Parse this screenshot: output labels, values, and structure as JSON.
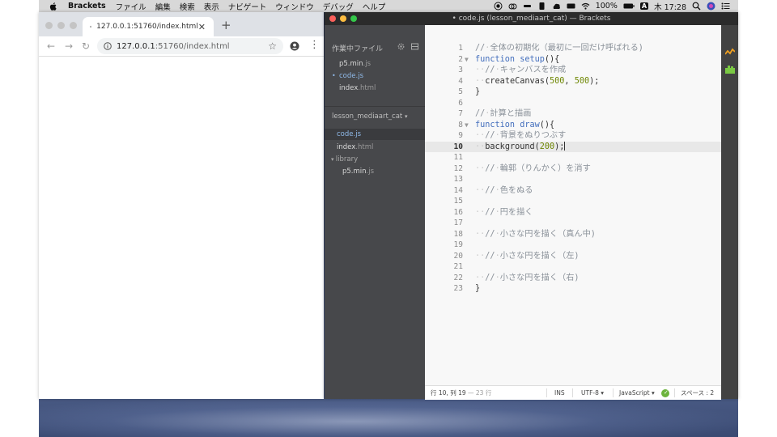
{
  "menubar": {
    "app_name": "Brackets",
    "items": [
      "ファイル",
      "編集",
      "検索",
      "表示",
      "ナビゲート",
      "ウィンドウ",
      "デバッグ",
      "ヘルプ"
    ],
    "battery": "100%",
    "input_indicator": "A",
    "clock": "木 17:28"
  },
  "chrome": {
    "tab_title": "127.0.0.1:51760/index.html",
    "url_host": "127.0.0.1",
    "url_rest": ":51760/index.html"
  },
  "brackets": {
    "title": "• code.js (lesson_mediaart_cat) — Brackets",
    "working_files_header": "作業中ファイル",
    "working_files": [
      {
        "name": "p5.min",
        "ext": ".js",
        "active": false
      },
      {
        "name": "code",
        "ext": ".js",
        "active": true
      },
      {
        "name": "index",
        "ext": ".html",
        "active": false
      }
    ],
    "project_name": "lesson_mediaart_cat",
    "project_caret": "▾",
    "tree": [
      {
        "name": "code",
        "ext": ".js",
        "selected": true
      },
      {
        "name": "index",
        "ext": ".html",
        "selected": false
      },
      {
        "name": "library",
        "ext": "",
        "folder": true
      },
      {
        "name": "p5.min",
        "ext": ".js",
        "selected": false
      }
    ],
    "code_lines": [
      {
        "n": "1",
        "text": "// 全体の初期化（最初に一回だけ呼ばれる)"
      },
      {
        "n": "2",
        "text": "function setup(){"
      },
      {
        "n": "3",
        "text": "  // キャンバスを作成"
      },
      {
        "n": "4",
        "text": "  createCanvas(500, 500);"
      },
      {
        "n": "5",
        "text": "}"
      },
      {
        "n": "6",
        "text": ""
      },
      {
        "n": "7",
        "text": "// 計算と描画"
      },
      {
        "n": "8",
        "text": "function draw(){"
      },
      {
        "n": "9",
        "text": "  // 背景をぬりつぶす"
      },
      {
        "n": "10",
        "text": "  background(200);"
      },
      {
        "n": "11",
        "text": ""
      },
      {
        "n": "12",
        "text": "  // 輪郭（りんかく）を消す"
      },
      {
        "n": "13",
        "text": ""
      },
      {
        "n": "14",
        "text": "  // 色をぬる"
      },
      {
        "n": "15",
        "text": ""
      },
      {
        "n": "16",
        "text": "  // 円を描く"
      },
      {
        "n": "17",
        "text": ""
      },
      {
        "n": "18",
        "text": "  // 小さな円を描く（真ん中)"
      },
      {
        "n": "19",
        "text": ""
      },
      {
        "n": "20",
        "text": "  // 小さな円を描く（左)"
      },
      {
        "n": "21",
        "text": ""
      },
      {
        "n": "22",
        "text": "  // 小さな円を描く（右)"
      },
      {
        "n": "23",
        "text": "}"
      }
    ],
    "status": {
      "cursor": "行 10, 列 19",
      "lines": "— 23 行",
      "mode": "INS",
      "encoding": "UTF-8 ▾",
      "language": "JavaScript ▾",
      "indent": "スペース : 2"
    }
  },
  "colors": {
    "sidebar_bg": "#47484b",
    "keyword": "#446fbd",
    "comment": "#8a9199",
    "number": "#6d8600",
    "lint_ok": "#6cb43c"
  }
}
